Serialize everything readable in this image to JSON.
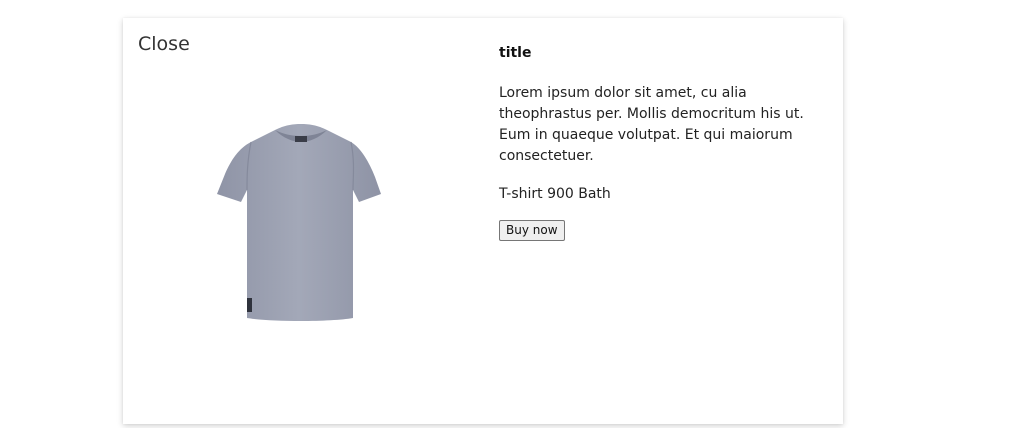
{
  "modal": {
    "close_label": "Close",
    "product": {
      "title": "title",
      "description": "Lorem ipsum dolor sit amet, cu alia theophrastus per. Mollis democritum his ut. Eum in quaeque volutpat. Et qui maiorum consectetuer.",
      "price_text": "T-shirt 900 Bath",
      "buy_label": "Buy now",
      "image_icon": "tshirt-image",
      "shirt_color": "#9da2b3"
    }
  }
}
